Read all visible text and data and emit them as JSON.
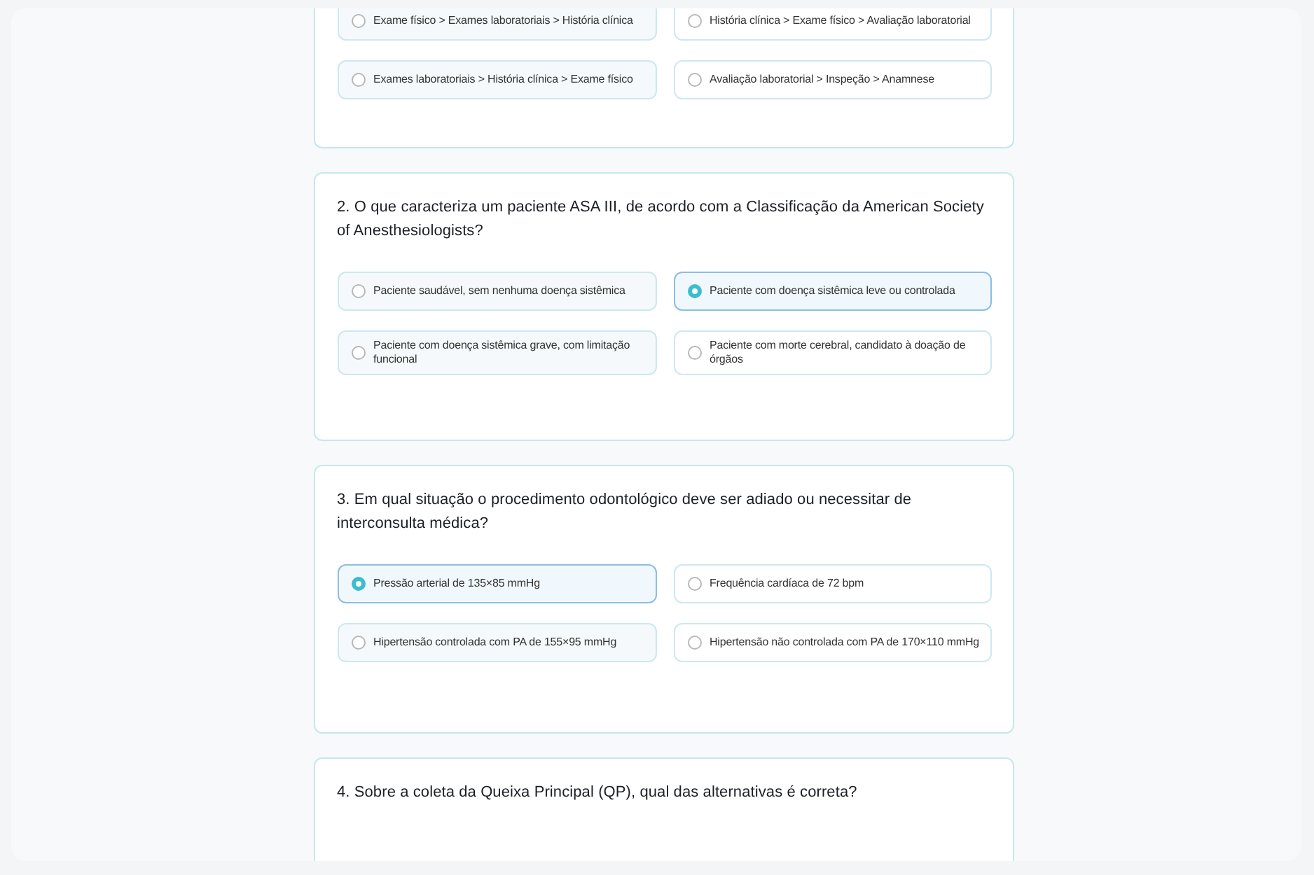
{
  "questions": [
    {
      "options": [
        {
          "text": "Exame físico > Exames laboratoriais > História clínica",
          "selected": false
        },
        {
          "text": "História clínica > Exame físico > Avaliação laboratorial",
          "selected": false
        },
        {
          "text": "Exames laboratoriais > História clínica > Exame físico",
          "selected": false
        },
        {
          "text": "Avaliação laboratorial > Inspeção > Anamnese",
          "selected": false
        }
      ]
    },
    {
      "question": "2. O que caracteriza um paciente ASA III, de acordo com a Classificação da American Society of Anesthesiologists?",
      "options": [
        {
          "text": "Paciente saudável, sem nenhuma doença sistêmica",
          "selected": false
        },
        {
          "text": "Paciente com doença sistêmica leve ou controlada",
          "selected": true
        },
        {
          "text": "Paciente com doença sistêmica grave, com limitação funcional",
          "selected": false
        },
        {
          "text": "Paciente com morte cerebral, candidato à doação de órgãos",
          "selected": false
        }
      ]
    },
    {
      "question": "3. Em qual situação o procedimento odontológico deve ser adiado ou necessitar de interconsulta médica?",
      "options": [
        {
          "text": "Pressão arterial de 135×85 mmHg",
          "selected": true
        },
        {
          "text": "Frequência cardíaca de 72 bpm",
          "selected": false
        },
        {
          "text": "Hipertensão controlada com PA de 155×95 mmHg",
          "selected": false
        },
        {
          "text": "Hipertensão não controlada com PA de 170×110 mmHg",
          "selected": false
        }
      ]
    },
    {
      "question": "4. Sobre a coleta da Queixa Principal (QP), qual das alternativas é correta?"
    }
  ]
}
